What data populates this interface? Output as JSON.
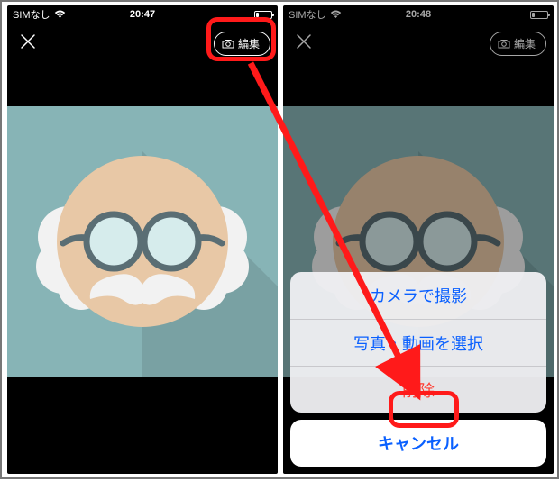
{
  "left": {
    "status": {
      "carrier": "SIMなし",
      "time": "20:47"
    },
    "nav": {
      "editLabel": "編集"
    }
  },
  "right": {
    "status": {
      "carrier": "SIMなし",
      "time": "20:48"
    },
    "nav": {
      "editLabel": "編集"
    },
    "sheet": {
      "option1": "カメラで撮影",
      "option2": "写真・動画を選択",
      "delete": "削除",
      "cancel": "キャンセル"
    }
  }
}
